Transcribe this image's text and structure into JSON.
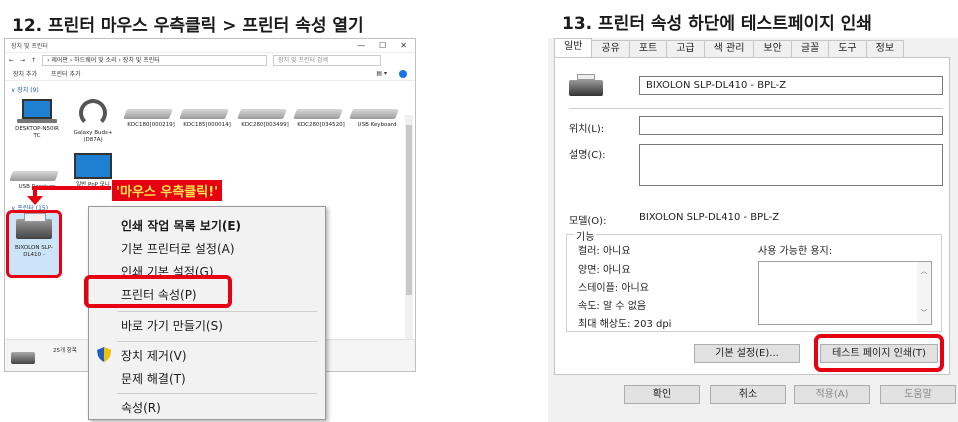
{
  "step1": {
    "title": "12. 프린터 마우스 우측클릭 > 프린터 속성 열기"
  },
  "step2": {
    "title": "13. 프린터 속성 하단에 테스트페이지 인쇄"
  },
  "explorer": {
    "window_title": "장치 및 프린터",
    "window_buttons": {
      "minimize": "—",
      "maximize": "☐",
      "close": "✕"
    },
    "address": "›  제어판  ›  하드웨어 및 소리  ›  장치 및 프린터",
    "search_placeholder": "장치 및 프린터 검색",
    "commands": {
      "add_device": "장치 추가",
      "add_printer": "프린터 추가"
    },
    "devices_group": "∨ 장치 (9)",
    "printers_group": "∨ 프린터 (15)",
    "devices": [
      {
        "label": "DESKTOP-N50IR TC",
        "icon": "laptop-icon"
      },
      {
        "label": "Galaxy Buds+ (D87A)",
        "icon": "headset-icon"
      },
      {
        "label": "KDC180[000219]",
        "icon": "keyboard-icon"
      },
      {
        "label": "KDC185[000014]",
        "icon": "keyboard-icon"
      },
      {
        "label": "KDC280[003499]",
        "icon": "keyboard-icon"
      },
      {
        "label": "KDC280[034520]",
        "icon": "keyboard-icon"
      },
      {
        "label": "USB Keyboard",
        "icon": "keyboard-icon"
      },
      {
        "label": "USB Receiver",
        "icon": "keyboard-icon"
      },
      {
        "label": "일반 PnP 모니",
        "icon": "monitor-icon"
      }
    ],
    "selected_printer": "BIXOLON SLP-DL410 -",
    "status_count": "25개 항목",
    "callout": "'마우스 우측클릭!'",
    "context_menu": [
      {
        "label": "인쇄 작업 목록 보기(E)",
        "bold": true
      },
      {
        "label": "기본 프린터로 설정(A)"
      },
      {
        "label": "인쇄 기본 설정(G)"
      },
      {
        "label": "프린터 속성(P)"
      },
      {
        "label": "바로 가기 만들기(S)"
      },
      {
        "label": "장치 제거(V)"
      },
      {
        "label": "문제 해결(T)"
      },
      {
        "label": "속성(R)"
      }
    ]
  },
  "dialog": {
    "tabs": [
      "일반",
      "공유",
      "포트",
      "고급",
      "색 관리",
      "보안",
      "글꼴",
      "도구",
      "정보"
    ],
    "printer_name": "BIXOLON SLP-DL410 - BPL-Z",
    "location_label": "위치(L):",
    "comment_label": "설명(C):",
    "model_label": "모델(O):",
    "model_value": "BIXOLON SLP-DL410 - BPL-Z",
    "features_label": "기능",
    "features": {
      "color": "컬러: 아니요",
      "duplex": "양면: 아니요",
      "staple": "스테이플: 아니요",
      "speed": "속도: 알 수 없음",
      "resolution": "최대 해상도: 203 dpi",
      "paper_label": "사용 가능한 용지:"
    },
    "pref_button": "기본 설정(E)...",
    "test_page_button": "테스트 페이지 인쇄(T)",
    "ok": "확인",
    "cancel": "취소",
    "apply": "적용(A)",
    "help": "도움말"
  }
}
